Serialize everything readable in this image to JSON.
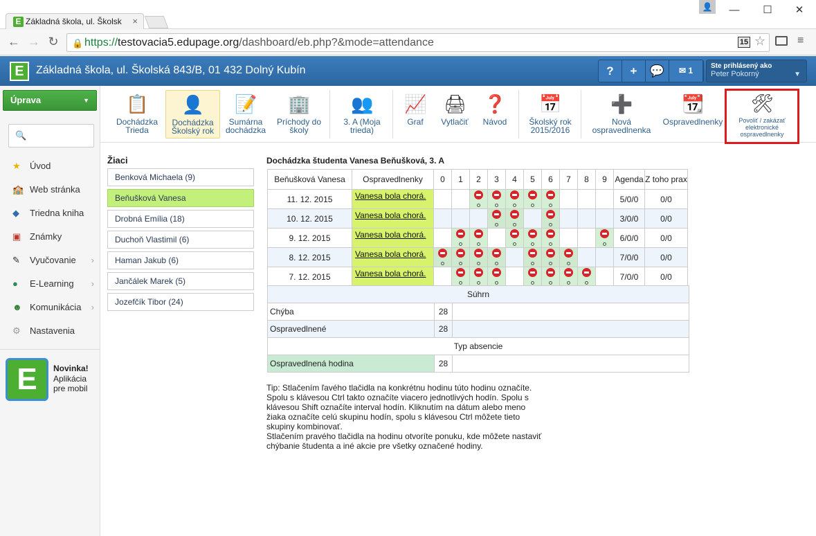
{
  "browser": {
    "tab_title": "Základná škola, ul. Školsk",
    "url_secure": "https://",
    "url_host": "testovacia5.edupage.org",
    "url_path": "/dashboard/eb.php?&mode=attendance",
    "ext_badge": "15"
  },
  "header": {
    "school_name": "Základná škola, ul. Školská 843/B, 01 432 Dolný Kubín",
    "mail_count": "1",
    "logged_label": "Ste prihlásený ako",
    "logged_user": "Peter Pokorný"
  },
  "sidebar": {
    "edit_button": "Úprava",
    "items": [
      {
        "label": "Úvod",
        "icon": "star-icon"
      },
      {
        "label": "Web stránka",
        "icon": "web-icon"
      },
      {
        "label": "Triedna kniha",
        "icon": "book-icon"
      },
      {
        "label": "Známky",
        "icon": "grades-icon"
      },
      {
        "label": "Vyučovanie",
        "icon": "teaching-icon"
      },
      {
        "label": "E-Learning",
        "icon": "elearning-icon"
      },
      {
        "label": "Komunikácia",
        "icon": "communication-icon"
      },
      {
        "label": "Nastavenia",
        "icon": "settings-icon"
      }
    ],
    "promo_title": "Novinka!",
    "promo_line1": "Aplikácia",
    "promo_line2": "pre mobil"
  },
  "ribbon": {
    "b1": [
      "Dochádzka",
      "Trieda"
    ],
    "b2": [
      "Dochádzka",
      "Školský rok"
    ],
    "b3": [
      "Sumárna",
      "dochádzka"
    ],
    "b4": [
      "Príchody do",
      "školy"
    ],
    "b5": [
      "3. A (Moja",
      "trieda)"
    ],
    "b6": "Graf",
    "b7": "Vytlačiť",
    "b8": "Návod",
    "b9": [
      "Školský rok",
      "2015/2016"
    ],
    "b10": [
      "Nová",
      "ospravedlnenka"
    ],
    "b11": "Ospravedlnenky",
    "b12": [
      "Povoliť / zakázať",
      "elektronické",
      "ospravedlnenky"
    ]
  },
  "students": {
    "heading": "Žiaci",
    "list": [
      "Benková Michaela (9)",
      "Beňušková Vanesa",
      "Drobná Emília (18)",
      "Duchoň Vlastimil (6)",
      "Haman Jakub (6)",
      "Jančálek Marek (5)",
      "Jozefčík Tibor (24)"
    ]
  },
  "attendance": {
    "title": "Dochádzka študenta Vanesa Beňušková, 3. A",
    "col_student": "Beňušková Vanesa",
    "col_excuse": "Ospravedlnenky",
    "hours": [
      "0",
      "1",
      "2",
      "3",
      "4",
      "5",
      "6",
      "7",
      "8",
      "9"
    ],
    "col_agenda": "Agenda",
    "col_prax": "Z toho prax",
    "rows": [
      {
        "date": "11. 12. 2015",
        "excuse": "Vanesa bola chorá.",
        "absent": [
          2,
          3,
          4,
          5,
          6
        ],
        "agenda": "5/0/0",
        "prax": "0/0"
      },
      {
        "date": "10. 12. 2015",
        "excuse": "Vanesa bola chorá.",
        "absent": [
          3,
          4,
          6
        ],
        "agenda": "3/0/0",
        "prax": "0/0"
      },
      {
        "date": "9. 12. 2015",
        "excuse": "Vanesa bola chorá.",
        "absent": [
          1,
          2,
          4,
          5,
          6,
          9
        ],
        "agenda": "6/0/0",
        "prax": "0/0"
      },
      {
        "date": "8. 12. 2015",
        "excuse": "Vanesa bola chorá.",
        "absent": [
          0,
          1,
          2,
          3,
          5,
          6,
          7
        ],
        "agenda": "7/0/0",
        "prax": "0/0"
      },
      {
        "date": "7. 12. 2015",
        "excuse": "Vanesa bola chorá.",
        "absent": [
          1,
          2,
          3,
          5,
          6,
          7,
          8
        ],
        "agenda": "7/0/0",
        "prax": "0/0"
      }
    ],
    "summary_label": "Súhrn",
    "error_label": "Chýba",
    "error_value": "28",
    "excused_label": "Ospravedlnené",
    "excused_value": "28",
    "absence_type": "Typ absencie",
    "excused_hour_label": "Ospravedlnená hodina",
    "excused_hour_value": "28"
  },
  "tip": {
    "p1": "Tip: Stlačením ľavého tlačidla na konkrétnu hodinu túto hodinu označíte. Spolu s klávesou Ctrl takto označíte viacero jednotlivých hodín. Spolu s klávesou Shift označíte interval hodín. Kliknutím na dátum alebo meno žiaka označíte celú skupinu hodín, spolu s klávesou Ctrl môžete tieto skupiny kombinovať.",
    "p2": "Stlačením pravého tlačidla na hodinu otvoríte ponuku, kde môžete nastaviť chýbanie študenta a iné akcie pre všetky označené hodiny."
  }
}
